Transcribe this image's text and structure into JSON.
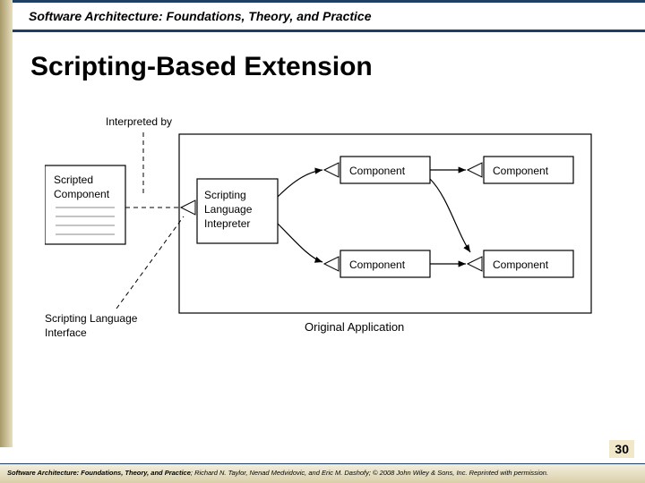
{
  "header": {
    "course_title": "Software Architecture: Foundations, Theory, and Practice"
  },
  "slide": {
    "title": "Scripting-Based Extension",
    "page_number": "30"
  },
  "diagram": {
    "labels": {
      "interpreted_by": "Interpreted by",
      "scripted_component_l1": "Scripted",
      "scripted_component_l2": "Component",
      "interpreter_l1": "Scripting",
      "interpreter_l2": "Language",
      "interpreter_l3": "Intepreter",
      "component": "Component",
      "sli_l1": "Scripting Language",
      "sli_l2": "Interface",
      "original_app": "Original Application"
    }
  },
  "footer": {
    "book": "Software Architecture: Foundations, Theory, and Practice",
    "rest": "; Richard N. Taylor, Nenad Medvidovic, and Eric M. Dashofy; © 2008 John Wiley & Sons, Inc. Reprinted with permission."
  }
}
